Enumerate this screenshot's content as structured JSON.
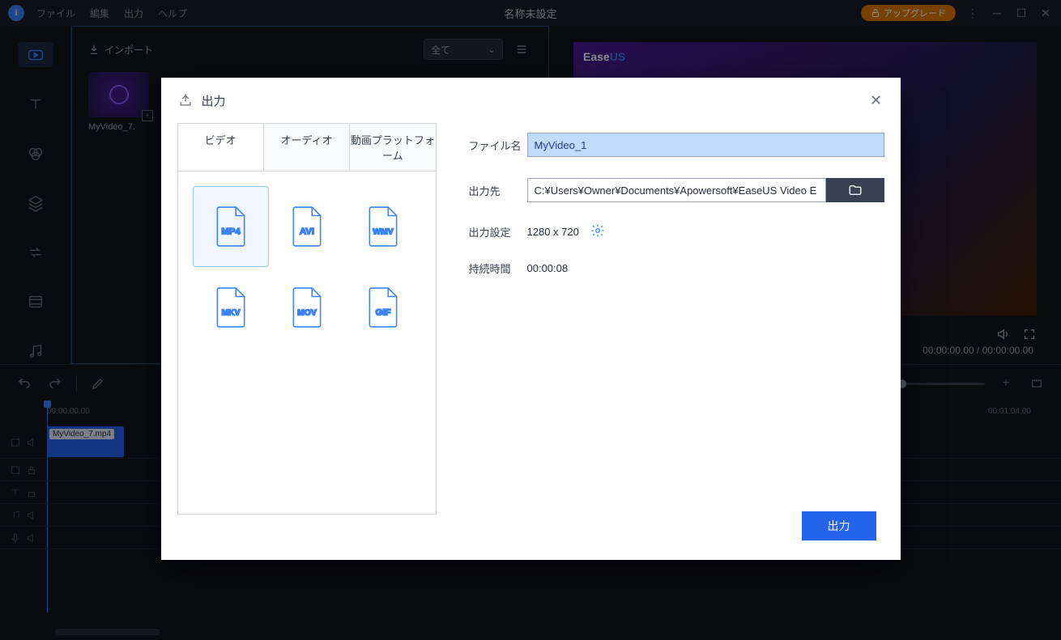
{
  "menubar": {
    "file": "ファイル",
    "edit": "編集",
    "export": "出力",
    "help": "ヘルプ",
    "title": "名称未設定",
    "upgrade": "アップグレード"
  },
  "media": {
    "import": "インポート",
    "filter": "全て",
    "thumb_label": "MyVideo_7."
  },
  "preview": {
    "brand_a": "Ease",
    "brand_b": "US",
    "time_current": "00:00:00.00",
    "time_total": "00:00:00.00",
    "time_sep": " / "
  },
  "ruler": {
    "t0": "00:00:00.00",
    "t1": "00:01:04.00"
  },
  "clip": {
    "label": "MyVideo_7.mp4"
  },
  "modal": {
    "title": "出力",
    "tabs": {
      "video": "ビデオ",
      "audio": "オーディオ",
      "platform": "動画プラットフォーム"
    },
    "formats": {
      "mp4": "MP4",
      "avi": "AVI",
      "wmv": "WMV",
      "mkv": "MKV",
      "mov": "MOV",
      "gif": "GIF"
    },
    "labels": {
      "filename": "ファイル名",
      "path": "出力先",
      "settings": "出力設定",
      "duration": "持続時間"
    },
    "filename": "MyVideo_1",
    "path": "C:¥Users¥Owner¥Documents¥Apowersoft¥EaseUS Video E",
    "resolution": "1280 x 720",
    "duration": "00:00:08",
    "export_btn": "出力"
  }
}
